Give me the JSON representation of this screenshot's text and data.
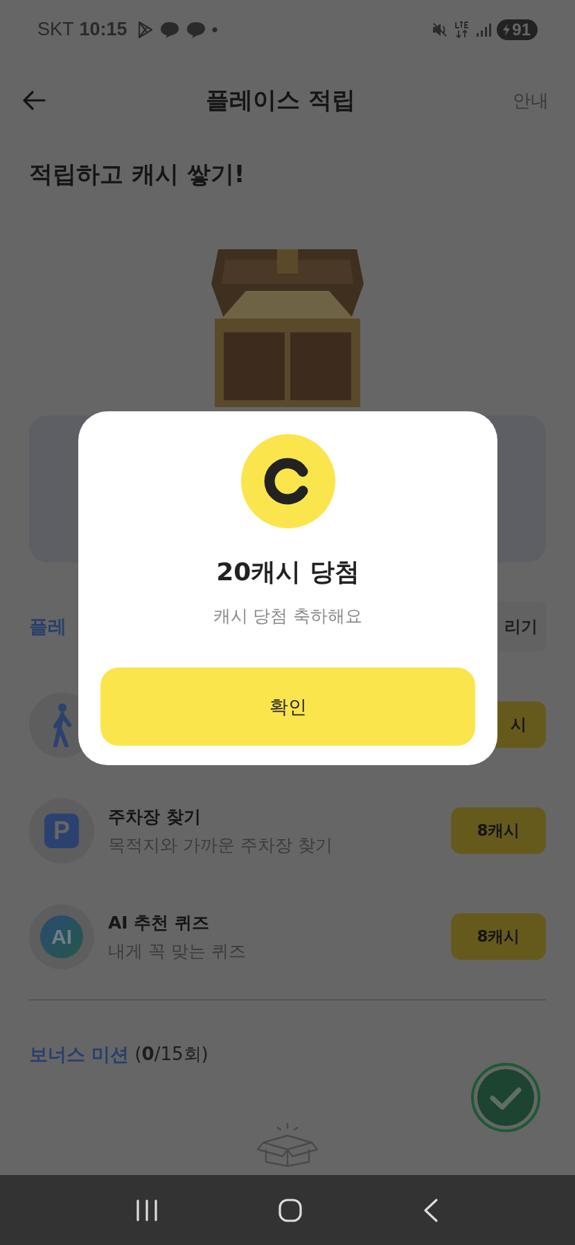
{
  "status_bar": {
    "carrier": "SKT",
    "time": "10:15",
    "battery": "91"
  },
  "header": {
    "title": "플레이스 적립",
    "action": "안내"
  },
  "headline": "적립하고 캐시 쌓기!",
  "section": {
    "title": "플레",
    "action": "리기"
  },
  "missions": [
    {
      "kind": "walk",
      "reward": "시"
    },
    {
      "kind": "parking",
      "icon_text": "P",
      "title": "주차장 찾기",
      "description": "목적지와 가까운 주차장 찾기",
      "reward": "8캐시"
    },
    {
      "kind": "ai",
      "icon_text": "AI",
      "title": "AI 추천 퀴즈",
      "description": "내게 꼭 맞는 퀴즈",
      "reward": "8캐시"
    }
  ],
  "bonus": {
    "title": "보너스 미션",
    "count": "(**0**/15회)"
  },
  "dialog": {
    "title": "20캐시 당첨",
    "message": "캐시 당첨 축하해요",
    "button": "확인"
  }
}
